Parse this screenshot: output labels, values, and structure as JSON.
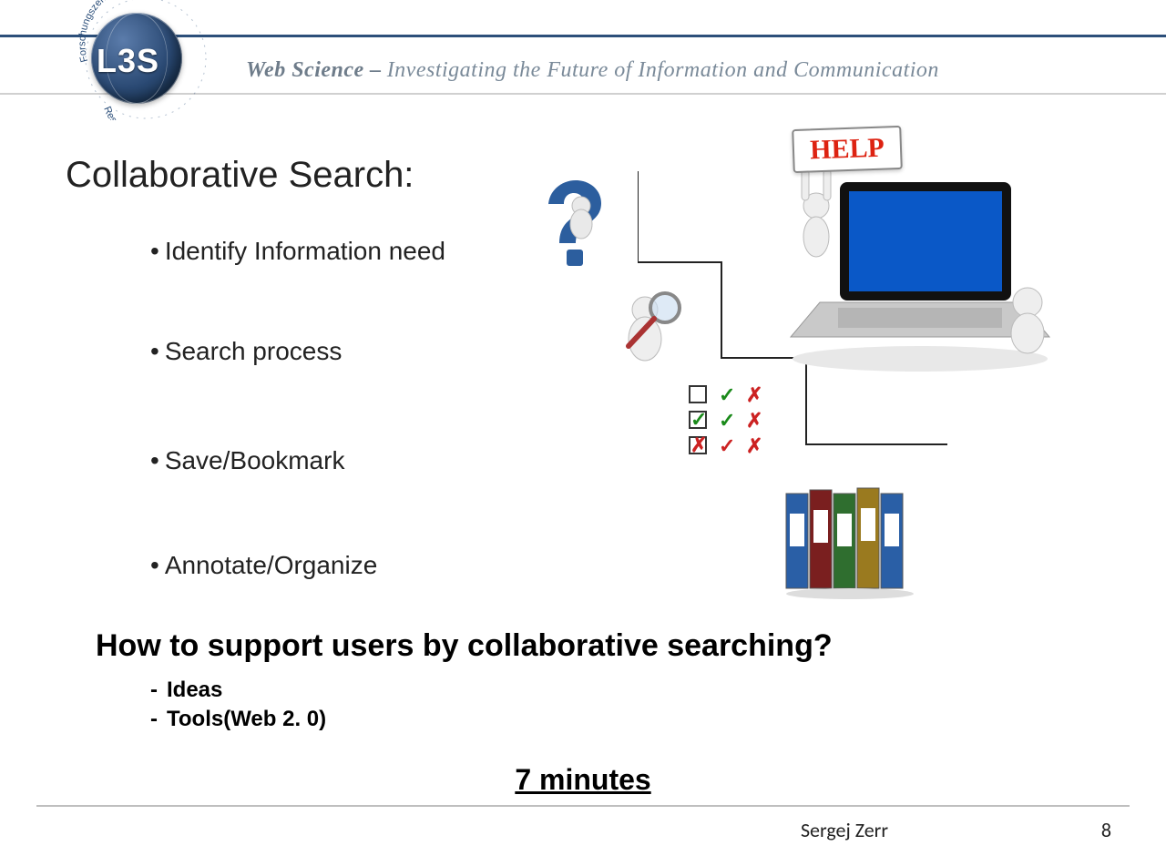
{
  "header": {
    "logo_label": "L3S",
    "ring_text_top": "Forschungszentrum",
    "ring_text_bot": "Research Center",
    "tagline_strong": "Web Science –",
    "tagline_rest": "Investigating the Future of Information and Communication"
  },
  "title": "Collaborative Search:",
  "bullets": [
    "Identify Information need",
    "Search process",
    "Save/Bookmark",
    "Annotate/Organize"
  ],
  "question": "How to support users by collaborative searching?",
  "subitems": [
    "Ideas",
    "Tools(Web 2. 0)"
  ],
  "time_label": "7 minutes",
  "help_sign": "HELP",
  "footer": {
    "author": "Sergej Zerr",
    "page": "8"
  },
  "icons": {
    "qmark": "question-mark-figure",
    "magnify": "magnifying-glass-figure",
    "checks": "checkbox-grid",
    "binders": "file-binders",
    "laptop": "laptop-help-figures"
  }
}
